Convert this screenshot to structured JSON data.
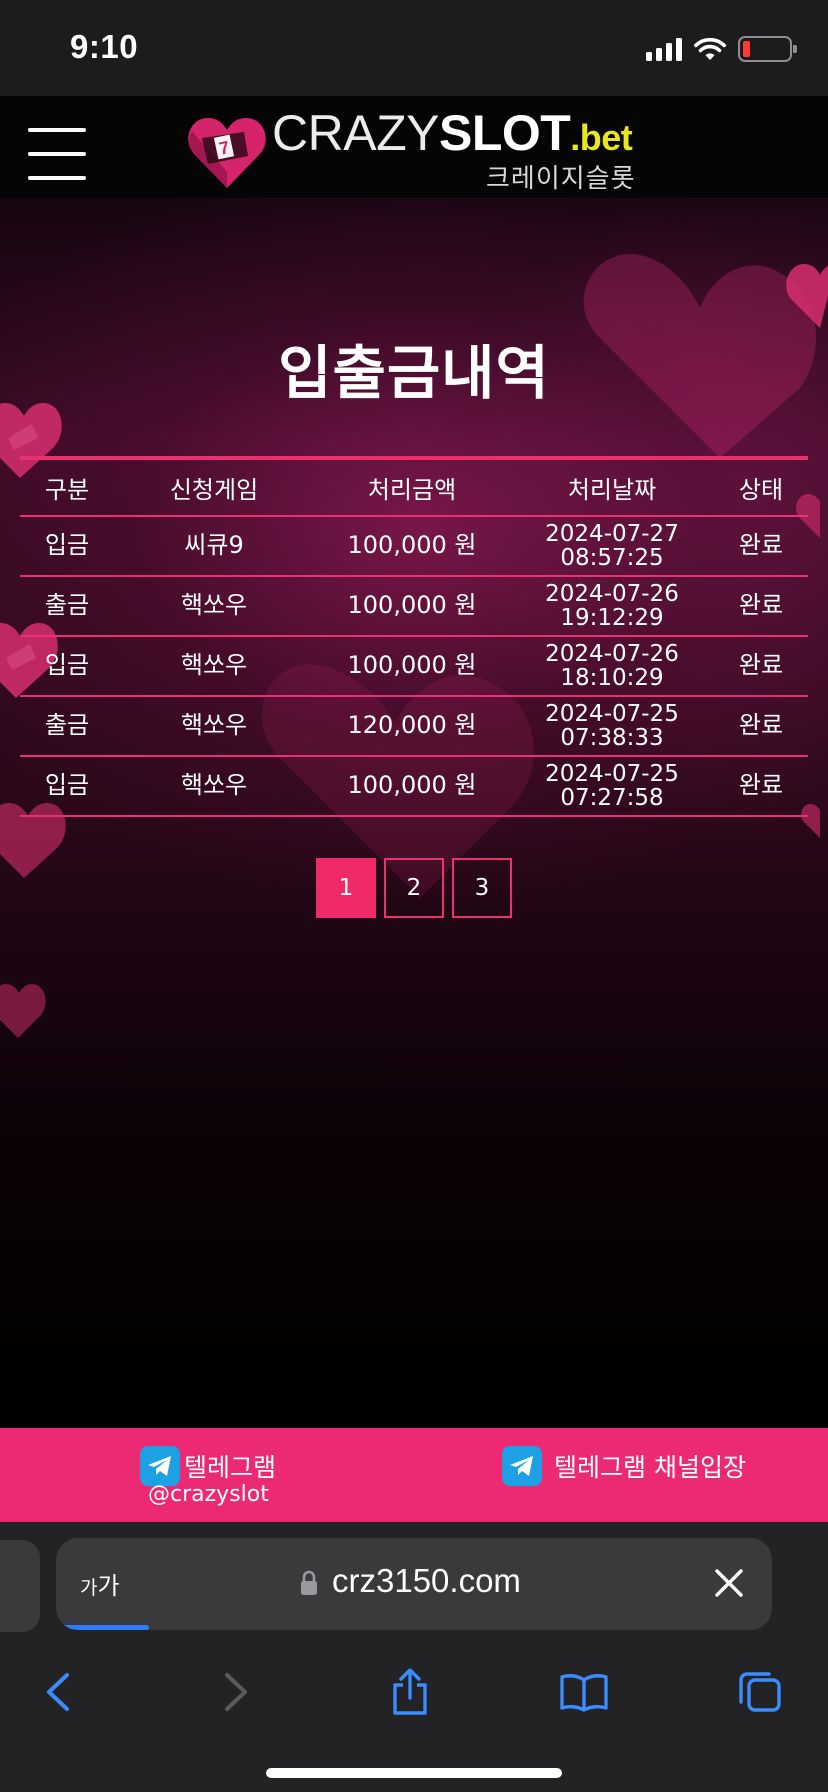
{
  "status_bar": {
    "time": "9:10",
    "battery_level": 0.15
  },
  "header": {
    "logo": {
      "crazy": "CRAZY",
      "slot": "SLOT",
      "bet": ".bet",
      "korean": "크레이지슬롯"
    }
  },
  "page": {
    "title": "입출금내역"
  },
  "table": {
    "columns": [
      "구분",
      "신청게임",
      "처리금액",
      "처리날짜",
      "상태"
    ],
    "rows": [
      {
        "type": "입금",
        "game": "씨큐9",
        "amount": "100,000 원",
        "date": "2024-07-27",
        "time": "08:57:25",
        "status": "완료"
      },
      {
        "type": "출금",
        "game": "핵쏘우",
        "amount": "100,000 원",
        "date": "2024-07-26",
        "time": "19:12:29",
        "status": "완료"
      },
      {
        "type": "입금",
        "game": "핵쏘우",
        "amount": "100,000 원",
        "date": "2024-07-26",
        "time": "18:10:29",
        "status": "완료"
      },
      {
        "type": "출금",
        "game": "핵쏘우",
        "amount": "120,000 원",
        "date": "2024-07-25",
        "time": "07:38:33",
        "status": "완료"
      },
      {
        "type": "입금",
        "game": "핵쏘우",
        "amount": "100,000 원",
        "date": "2024-07-25",
        "time": "07:27:58",
        "status": "완료"
      }
    ]
  },
  "pagination": {
    "pages": [
      "1",
      "2",
      "3"
    ],
    "current": "1"
  },
  "telegram_bar": {
    "left_label": "텔레그램",
    "left_handle": "@crazyslot",
    "right_label": "텔레그램 채널입장"
  },
  "browser": {
    "aa_small": "가",
    "aa_large": "가",
    "url": "crz3150.com",
    "load_progress": 0.13
  },
  "colors": {
    "accent": "#ec2a73",
    "table_line": "#ea3070",
    "active_page": "#f02a68",
    "logo_bet": "#e8e61c",
    "telegram_blue": "#1ea0e4",
    "safari_blue": "#2d7cf6"
  }
}
